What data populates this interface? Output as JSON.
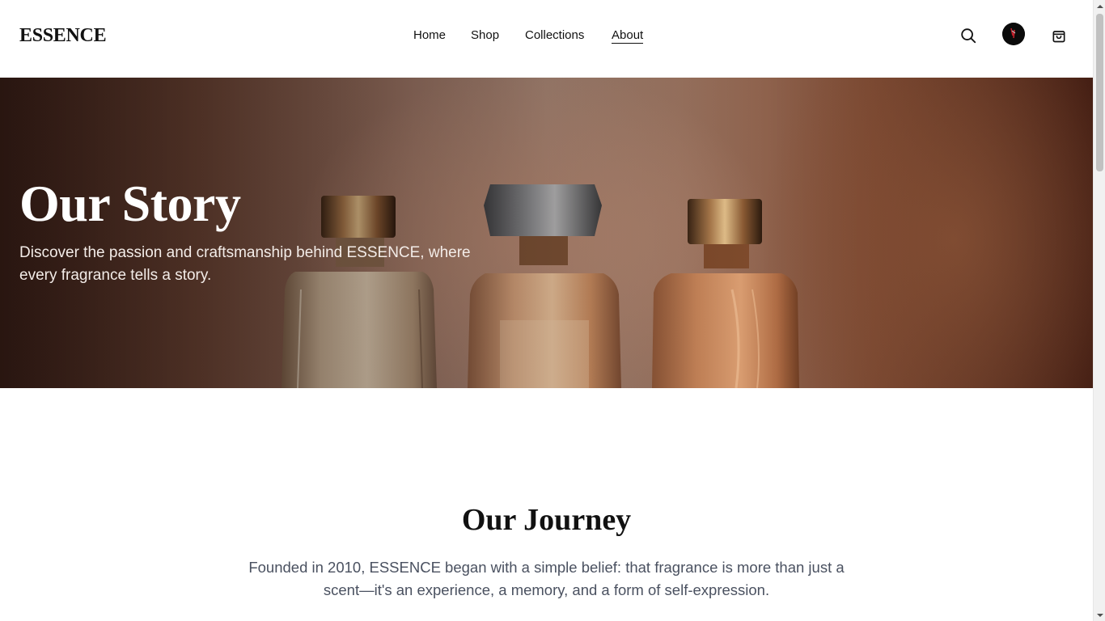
{
  "header": {
    "logo": "ESSENCE",
    "nav": [
      {
        "label": "Home"
      },
      {
        "label": "Shop"
      },
      {
        "label": "Collections"
      },
      {
        "label": "About"
      }
    ],
    "active_nav": "About",
    "icons": {
      "search": "search-icon",
      "account": "avatar",
      "cart": "shopping-bag-icon"
    }
  },
  "hero": {
    "title": "Our Story",
    "subtitle": "Discover the passion and craftsmanship behind ESSENCE, where every fragrance tells a story."
  },
  "journey": {
    "title": "Our Journey",
    "text": "Founded in 2010, ESSENCE began with a simple belief: that fragrance is more than just a scent—it's an experience, a memory, and a form of self-expression."
  },
  "colors": {
    "text_primary": "#111111",
    "text_secondary": "#4a5160",
    "hero_tone": "#8a5236"
  }
}
